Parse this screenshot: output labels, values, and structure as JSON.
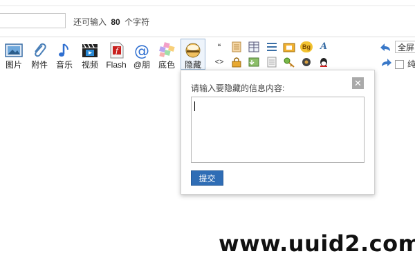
{
  "editor": {
    "title_input_value": "",
    "char_hint_prefix": "还可输入",
    "char_hint_count": "80",
    "char_hint_suffix": "个字符"
  },
  "toolbar": {
    "tools": [
      {
        "label": "图片",
        "icon": "image-icon"
      },
      {
        "label": "附件",
        "icon": "paperclip-icon"
      },
      {
        "label": "音乐",
        "icon": "music-note-icon"
      },
      {
        "label": "视频",
        "icon": "video-icon"
      },
      {
        "label": "Flash",
        "icon": "flash-icon"
      },
      {
        "label": "@朋",
        "icon": "at-icon"
      },
      {
        "label": "底色",
        "icon": "background-color-icon"
      },
      {
        "label": "隐藏",
        "icon": "hide-content-icon"
      }
    ],
    "mini_row1_quote": "“",
    "mini_row2_code": "<>",
    "bg_badge": "Bg",
    "font_letter": "A",
    "fullscreen_label": "全屏",
    "pure_label": "纯"
  },
  "hide_popup": {
    "title": "请输入要隐藏的信息内容:",
    "close_symbol": "✕",
    "textarea_value": "",
    "submit_label": "提交"
  },
  "watermark": "www.uuid2.com"
}
